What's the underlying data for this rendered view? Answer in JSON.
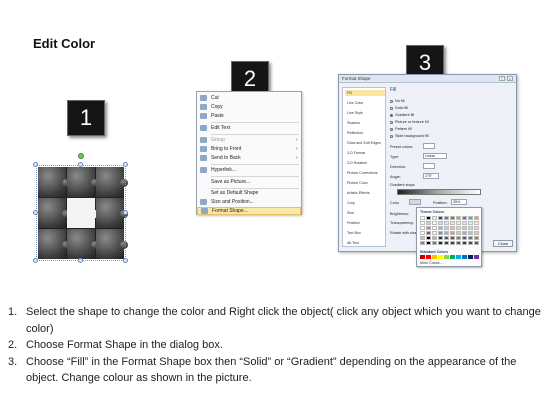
{
  "title": "Edit Color",
  "steps": {
    "one": "1",
    "two": "2",
    "three": "3"
  },
  "context_menu": {
    "items": [
      {
        "label": "Cut",
        "arrow": ""
      },
      {
        "label": "Copy",
        "arrow": ""
      },
      {
        "label": "Paste",
        "arrow": ""
      },
      {
        "label": "Edit Text",
        "arrow": ""
      },
      {
        "label": "Group",
        "arrow": "›"
      },
      {
        "label": "Bring to Front",
        "arrow": "›"
      },
      {
        "label": "Send to Back",
        "arrow": "›"
      },
      {
        "label": "Hyperlink...",
        "arrow": ""
      },
      {
        "label": "Save as Picture...",
        "arrow": ""
      },
      {
        "label": "Set as Default Shape",
        "arrow": ""
      },
      {
        "label": "Size and Position...",
        "arrow": ""
      },
      {
        "label": "Format Shape...",
        "arrow": ""
      }
    ]
  },
  "dialog": {
    "title": "Format Shape",
    "close_glyph": "x",
    "categories": [
      "Fill",
      "Line Color",
      "Line Style",
      "Shadow",
      "Reflection",
      "Glow and Soft Edges",
      "3-D Format",
      "3-D Rotation",
      "Picture Corrections",
      "Picture Color",
      "Artistic Effects",
      "Crop",
      "Size",
      "Position",
      "Text Box",
      "Alt Text"
    ],
    "pane_heading": "Fill",
    "fill_options": [
      "No fill",
      "Solid fill",
      "Gradient fill",
      "Picture or texture fill",
      "Pattern fill",
      "Slide background fill"
    ],
    "fields": {
      "preset": "Preset colors:",
      "type": "Type:",
      "type_value": "Linear",
      "direction": "Direction:",
      "angle": "Angle:",
      "angle_value": "270°",
      "stops": "Gradient stops",
      "color": "Color",
      "position": "Position:",
      "position_value": "35%",
      "brightness": "Brightness:",
      "transparency": "Transparency:",
      "rotate": "Rotate with shape"
    },
    "close_button": "Close"
  },
  "color_picker": {
    "theme_label": "Theme Colors",
    "standard_label": "Standard Colors",
    "more_label": "More Colors...",
    "theme_colors": [
      "#ffffff",
      "#000000",
      "#eeece1",
      "#1f497d",
      "#4f81bd",
      "#c0504d",
      "#9bbb59",
      "#8064a2",
      "#4bacc6",
      "#f79646"
    ],
    "standard_colors": [
      "#c00000",
      "#ff0000",
      "#ffc000",
      "#ffff00",
      "#92d050",
      "#00b050",
      "#00b0f0",
      "#0070c0",
      "#002060",
      "#7030a0"
    ]
  },
  "instructions": [
    {
      "num": "1.",
      "text": "Select the shape to change the color and Right click the object( click any object which you want to change color)"
    },
    {
      "num": "2.",
      "text": "Choose Format Shape in the dialog box."
    },
    {
      "num": "3.",
      "text": "Choose “Fill” in the Format Shape box then “Solid” or “Gradient” depending on the appearance of the object. Change colour as shown in the picture."
    }
  ]
}
